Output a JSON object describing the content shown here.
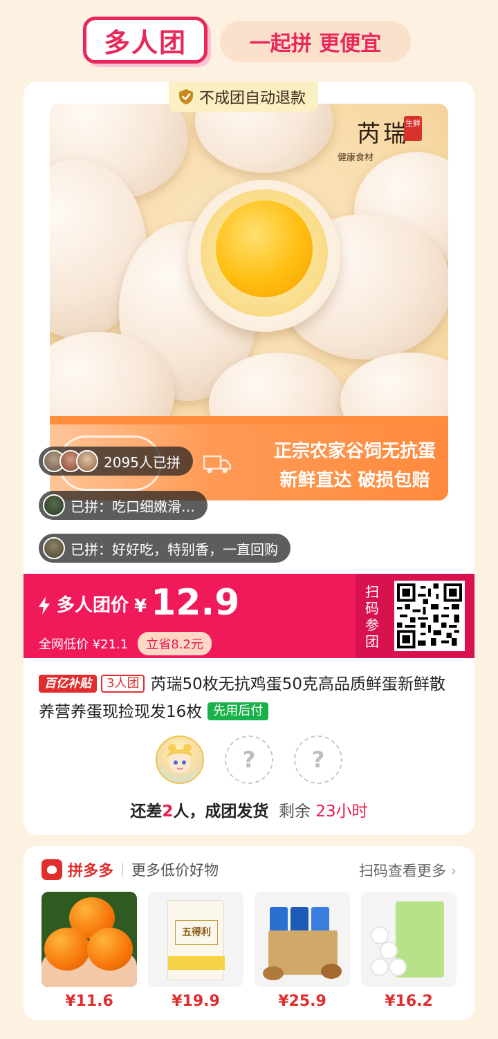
{
  "header": {
    "logo": "多人团",
    "slogan": "一起拼 更便宜"
  },
  "product": {
    "refund_tag": "不成团自动退款",
    "brand_name": "芮瑞",
    "brand_seal": "生鲜",
    "brand_sub": "健康食材",
    "banner_line1": "正宗农家谷饲无抗蛋",
    "banner_line2": "新鲜直达 破损包赔"
  },
  "bubbles": {
    "count": "2095人已拼",
    "review1": "已拼：吃口细嫩滑…",
    "review2": "已拼：好好吃，特别香，一直回购"
  },
  "price": {
    "label": "多人团价",
    "currency": "¥",
    "value": "12.9",
    "orig_label": "全网低价 ¥21.1",
    "save": "立省8.2元",
    "scan_label": "扫码参团"
  },
  "title": {
    "badge_subsidy": "百亿补贴",
    "badge_team": "3人团",
    "text": "芮瑞50枚无抗鸡蛋50克高品质鲜蛋新鲜散养营养蛋现捡现发16枚",
    "badge_pay": "先用后付"
  },
  "group": {
    "empty_mark": "?",
    "status_prefix": "还差",
    "status_count": "2",
    "status_suffix": "人，成团发货",
    "remain_label": "剩余",
    "remain_time": "23小时"
  },
  "recommend": {
    "app_name": "拼多多",
    "title": "更多低价好物",
    "more": "扫码查看更多",
    "products": [
      {
        "name": "orange",
        "price": "¥11.6"
      },
      {
        "name": "flour",
        "price": "¥19.9"
      },
      {
        "name": "snacks",
        "price": "¥25.9"
      },
      {
        "name": "tissue",
        "price": "¥16.2"
      }
    ],
    "flour_label": "五得利"
  },
  "colors": {
    "accent": "#e8285a",
    "price_bar": "#f0195a",
    "pay_green": "#19b24a",
    "background": "#fdf1e2"
  }
}
